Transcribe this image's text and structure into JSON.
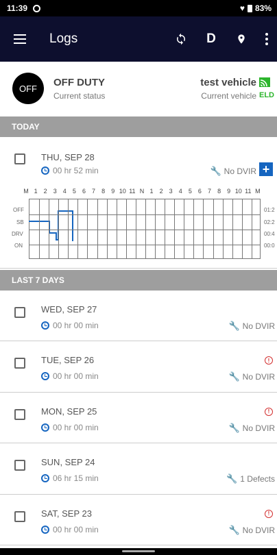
{
  "status_bar": {
    "time": "11:39",
    "battery": "83%"
  },
  "app_bar": {
    "title": "Logs",
    "driver_initial": "D"
  },
  "current": {
    "duty_badge": "OFF",
    "duty_status": "OFF DUTY",
    "duty_caption": "Current status",
    "vehicle": "test vehicle",
    "vehicle_caption": "Current vehicle",
    "eld": "ELD"
  },
  "sections": {
    "today": "TODAY",
    "last7": "LAST 7 DAYS"
  },
  "today": {
    "date": "THU, SEP 28",
    "duration": "00 hr 52 min",
    "dvir": "No DVIR",
    "hour_labels": [
      "M",
      "1",
      "2",
      "3",
      "4",
      "5",
      "6",
      "7",
      "8",
      "9",
      "10",
      "11",
      "N",
      "1",
      "2",
      "3",
      "4",
      "5",
      "6",
      "7",
      "8",
      "9",
      "10",
      "11",
      "M"
    ],
    "status_labels": [
      "OFF",
      "SB",
      "DRV",
      "ON"
    ],
    "totals": [
      "01:2",
      "02:2",
      "00:4",
      "00:0"
    ]
  },
  "days": [
    {
      "date": "WED, SEP 27",
      "duration": "00 hr 00 min",
      "dvir": "No DVIR",
      "violation": false
    },
    {
      "date": "TUE, SEP 26",
      "duration": "00 hr 00 min",
      "dvir": "No DVIR",
      "violation": true
    },
    {
      "date": "MON, SEP 25",
      "duration": "00 hr 00 min",
      "dvir": "No DVIR",
      "violation": true
    },
    {
      "date": "SUN, SEP 24",
      "duration": "06 hr 15 min",
      "dvir": "1 Defects",
      "violation": false
    },
    {
      "date": "SAT, SEP 23",
      "duration": "00 hr 00 min",
      "dvir": "No DVIR",
      "violation": true
    }
  ],
  "colors": {
    "appbar": "#0d0f2e",
    "accent": "#1565c0",
    "section": "#9e9e9e",
    "eld_green": "#2cb52c",
    "violation": "#d32f2f"
  }
}
